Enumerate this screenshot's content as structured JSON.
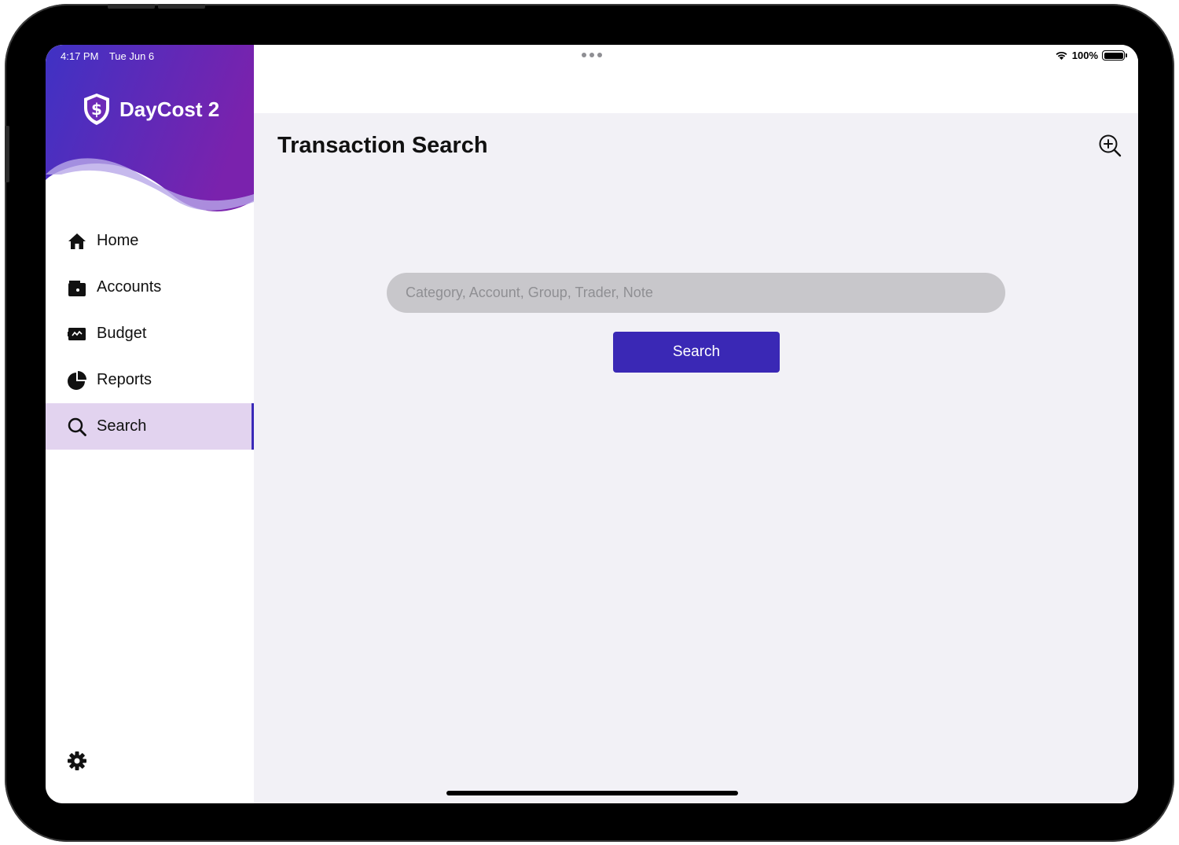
{
  "status_bar": {
    "time": "4:17 PM",
    "date": "Tue Jun 6",
    "battery": "100%",
    "battery_level": 1.0,
    "wifi_icon": "wifi-icon"
  },
  "sidebar": {
    "app_name": "DayCost 2",
    "logo_icon": "shield-dollar-icon",
    "items": [
      {
        "label": "Home",
        "icon": "home-icon",
        "active": false
      },
      {
        "label": "Accounts",
        "icon": "wallet-icon",
        "active": false
      },
      {
        "label": "Budget",
        "icon": "budget-icon",
        "active": false
      },
      {
        "label": "Reports",
        "icon": "pie-chart-icon",
        "active": false
      },
      {
        "label": "Search",
        "icon": "search-icon",
        "active": true
      }
    ],
    "settings_icon": "gear-icon"
  },
  "main": {
    "title": "Transaction Search",
    "zoom_icon": "zoom-in-icon",
    "search": {
      "placeholder": "Category, Account, Group, Trader, Note",
      "value": "",
      "button_label": "Search"
    }
  },
  "colors": {
    "brand_gradient_start": "#3f32c4",
    "brand_gradient_end": "#7a22ad",
    "accent": "#3a28b5",
    "active_item_bg": "#e2d3ef",
    "content_bg": "#f2f1f6",
    "input_bg": "#c8c7cb"
  }
}
